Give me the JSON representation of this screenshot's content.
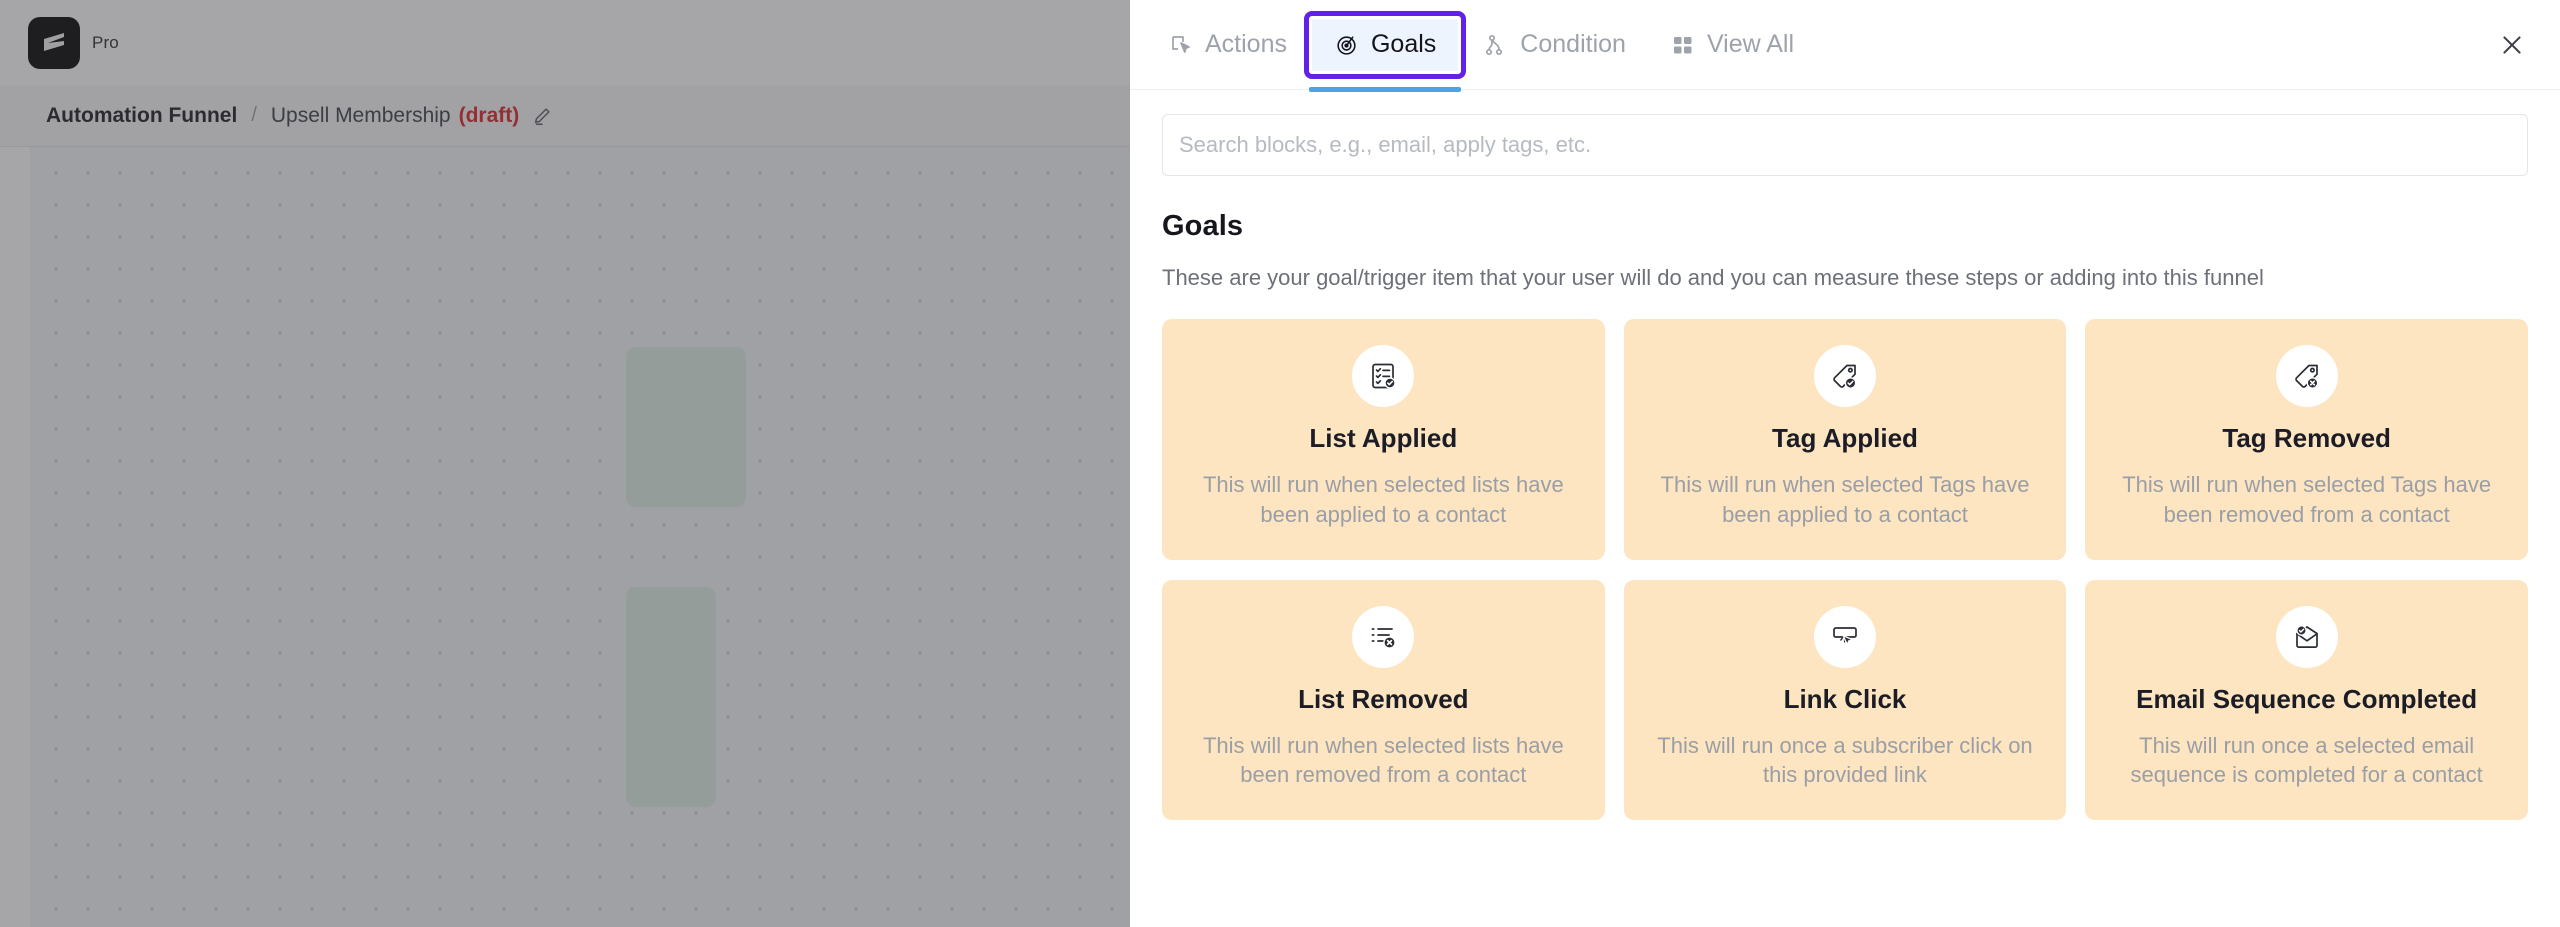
{
  "app": {
    "logo_icon": "flash-logo-icon",
    "plan_label": "Pro",
    "breadcrumb": {
      "root": "Automation Funnel",
      "separator": "/",
      "current": "Upsell Membership",
      "status": "(draft)",
      "edit_icon": "pencil-edit-icon"
    }
  },
  "panel": {
    "close_icon": "close-icon",
    "tabs": [
      {
        "label": "Actions",
        "icon": "actions-cursor-icon",
        "active": false
      },
      {
        "label": "Goals",
        "icon": "goals-target-icon",
        "active": true
      },
      {
        "label": "Condition",
        "icon": "condition-branch-icon",
        "active": false
      },
      {
        "label": "View All",
        "icon": "grid-view-all-icon",
        "active": false
      }
    ],
    "search": {
      "placeholder": "Search blocks, e.g., email, apply tags, etc.",
      "value": ""
    },
    "section": {
      "title": "Goals",
      "description": "These are your goal/trigger item that your user will do and you can measure these steps or adding into this funnel"
    },
    "cards": [
      {
        "title": "List Applied",
        "description": "This will run when selected lists have been applied to a contact",
        "icon": "list-check-applied-icon"
      },
      {
        "title": "Tag Applied",
        "description": "This will run when selected Tags have been applied to a contact",
        "icon": "tag-check-applied-icon"
      },
      {
        "title": "Tag Removed",
        "description": "This will run when selected Tags have been removed from a contact",
        "icon": "tag-x-removed-icon"
      },
      {
        "title": "List Removed",
        "description": "This will run when selected lists have been removed from a contact",
        "icon": "list-x-removed-icon"
      },
      {
        "title": "Link Click",
        "description": "This will run once a subscriber click on this provided link",
        "icon": "link-click-cursor-icon"
      },
      {
        "title": "Email Sequence Completed",
        "description": "This will run once a selected email sequence is completed for a contact",
        "icon": "email-check-icon"
      }
    ]
  },
  "colors": {
    "accent_purple": "#6320e8",
    "tab_underline_blue": "#4aa3e8",
    "card_background": "#fce5c0",
    "draft_red": "#e02424"
  }
}
